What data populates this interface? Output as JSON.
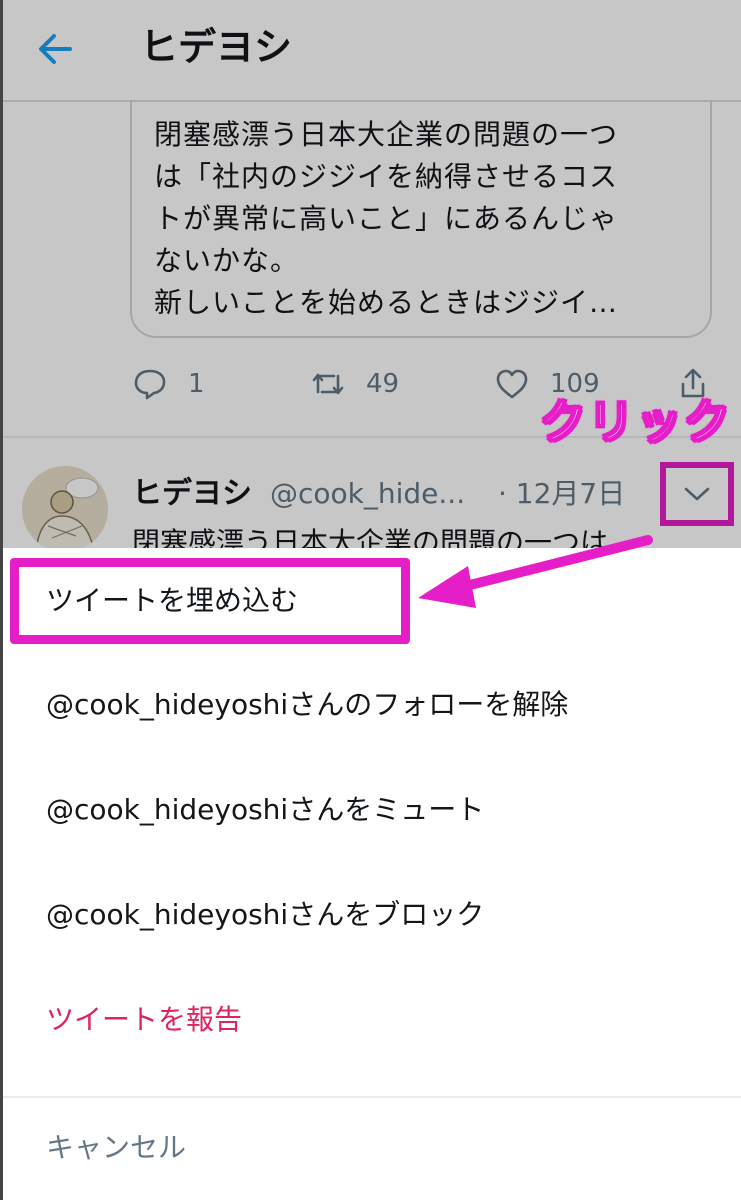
{
  "header": {
    "title": "ヒデヨシ",
    "back_icon": "arrow-left-icon",
    "accent": "#1da1f2"
  },
  "quoted_tweet": {
    "text": "閉塞感漂う日本大企業の問題の一つ\nは「社内のジジイを納得させるコス\nトが異常に高いこと」にあるんじゃ\nないかな。\n新しいことを始めるときはジジイ…"
  },
  "actions": {
    "reply_count": "1",
    "retweet_count": "49",
    "like_count": "109"
  },
  "tweet": {
    "name": "ヒデヨシ",
    "handle": "@cook_hide...",
    "date": "· 12月7日",
    "body": "閉塞感漂う日本大企業の問題の一つは"
  },
  "annotation": {
    "callout": "クリック",
    "color": "#e61ec8"
  },
  "menu": {
    "embed": "ツイートを埋め込む",
    "unfollow": "@cook_hideyoshiさんのフォローを解除",
    "mute": "@cook_hideyoshiさんをミュート",
    "block": "@cook_hideyoshiさんをブロック",
    "report": "ツイートを報告",
    "cancel": "キャンセル",
    "report_color": "#e0245e"
  }
}
